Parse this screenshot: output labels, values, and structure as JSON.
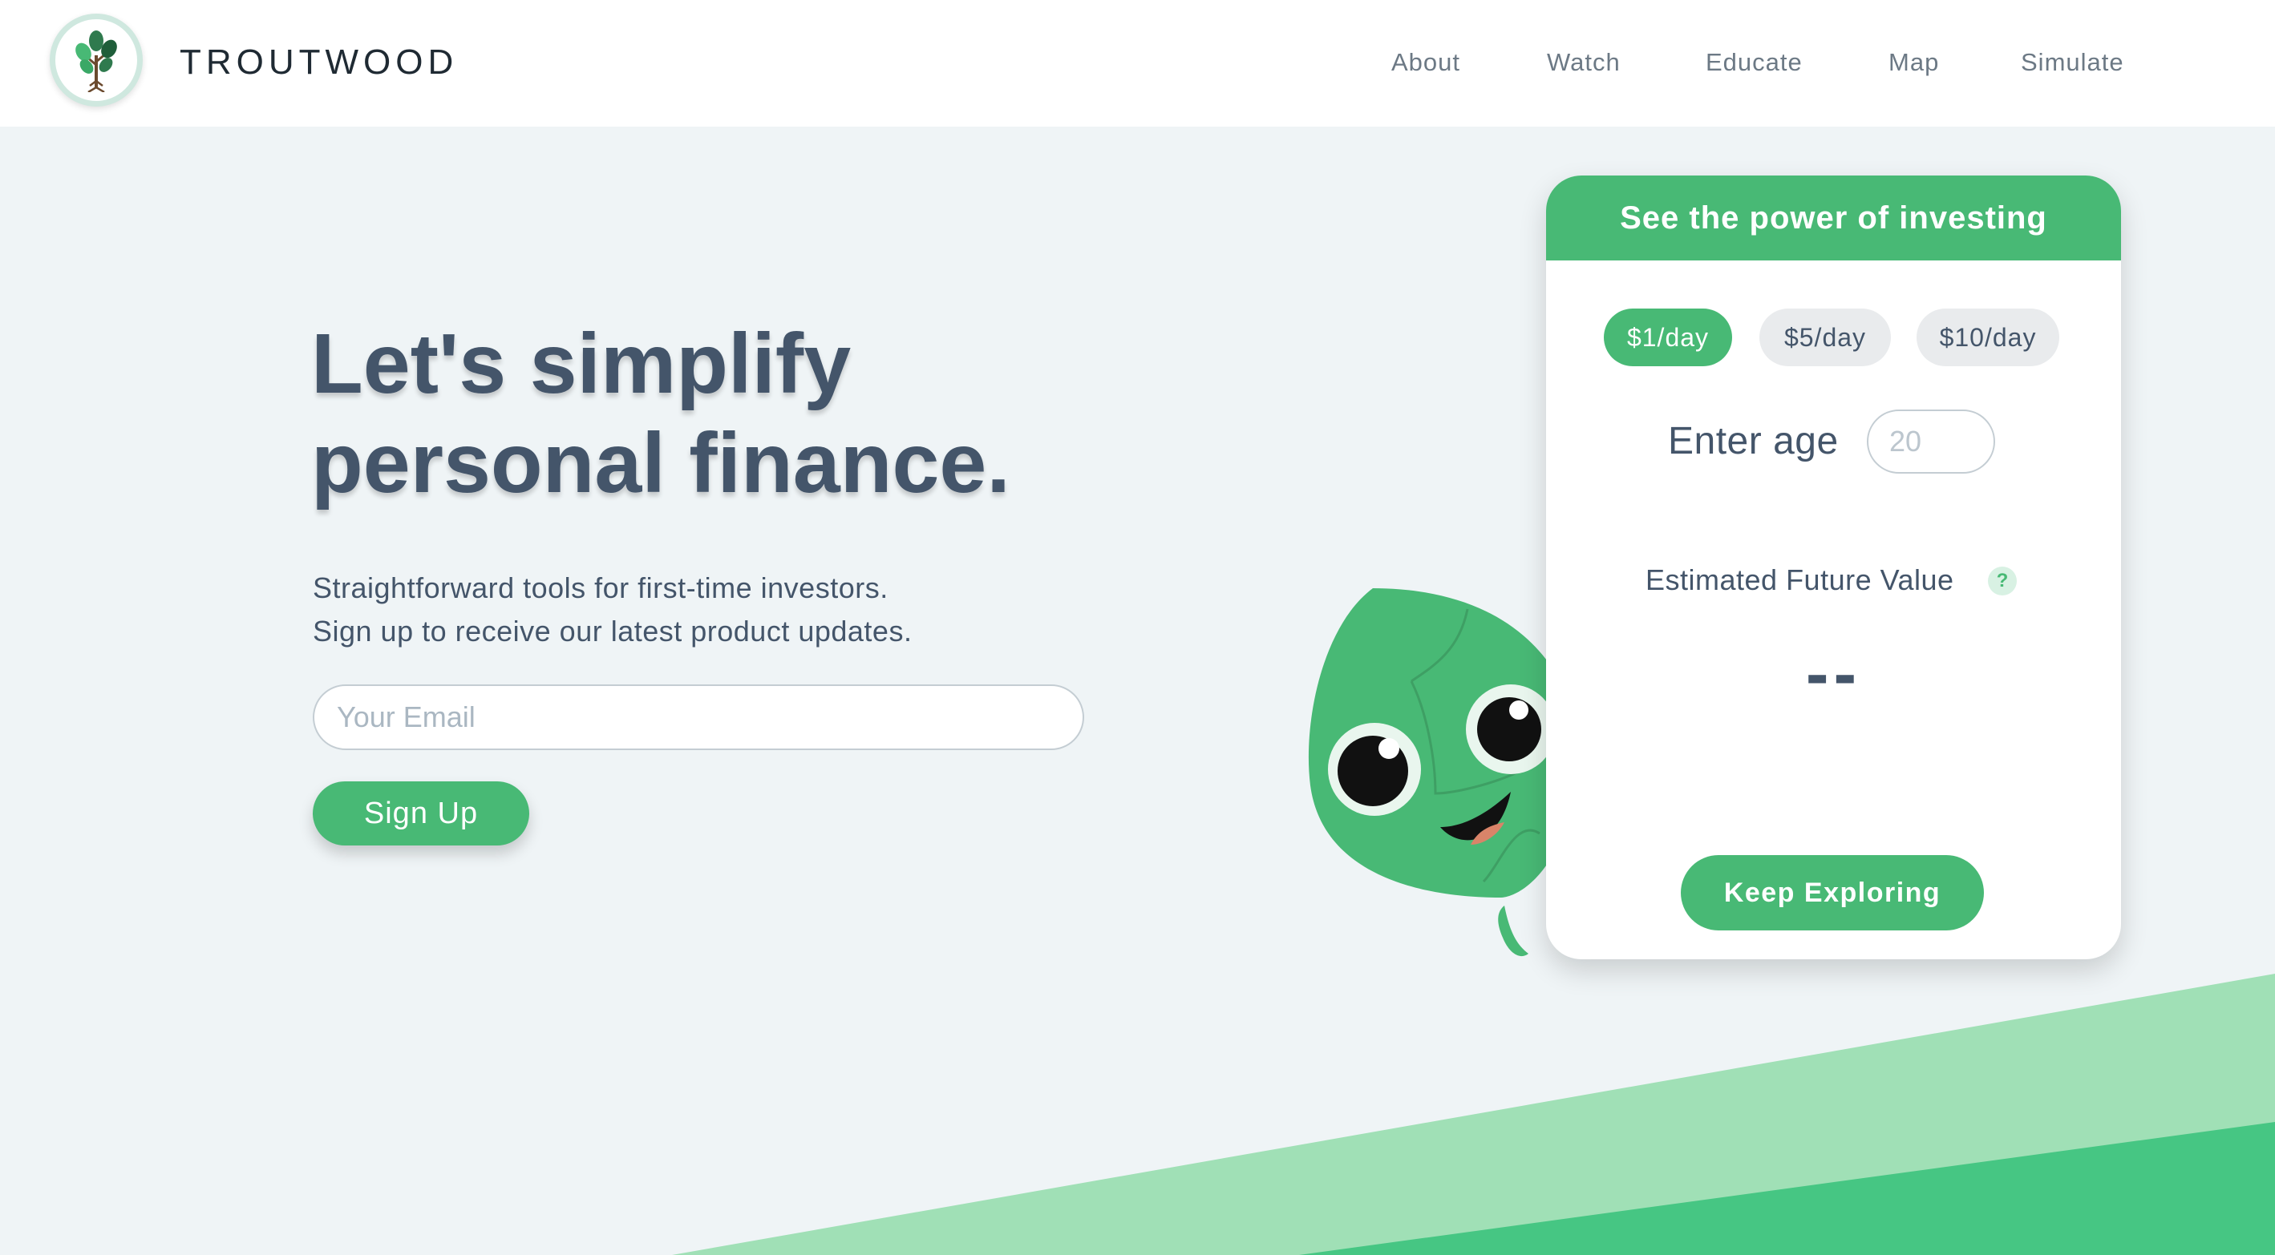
{
  "brand": {
    "name": "TROUTWOOD",
    "logo_icon": "tree-icon"
  },
  "nav": {
    "items": [
      {
        "label": "About"
      },
      {
        "label": "Watch"
      },
      {
        "label": "Educate"
      },
      {
        "label": "Map"
      },
      {
        "label": "Simulate"
      }
    ]
  },
  "hero": {
    "title_line1": "Let's simplify",
    "title_line2": "personal finance.",
    "subtitle_line1": "Straightforward tools for first-time investors.",
    "subtitle_line2": "Sign up to receive our latest product updates.",
    "email_placeholder": "Your Email",
    "signup_label": "Sign Up"
  },
  "calculator": {
    "title": "See the power of investing",
    "options": [
      {
        "label": "$1/day",
        "selected": true
      },
      {
        "label": "$5/day",
        "selected": false
      },
      {
        "label": "$10/day",
        "selected": false
      }
    ],
    "age_label": "Enter age",
    "age_placeholder": "20",
    "result_label": "Estimated Future Value",
    "help_glyph": "?",
    "result_value": "--",
    "cta_label": "Keep Exploring"
  },
  "mascot": {
    "icon": "leaf-mascot-icon"
  },
  "colors": {
    "brand_green": "#48b975",
    "wedge_light": "#a0e0b6",
    "wedge_dark": "#46c683",
    "text_primary": "#44556a",
    "page_bg": "#eff4f6"
  }
}
